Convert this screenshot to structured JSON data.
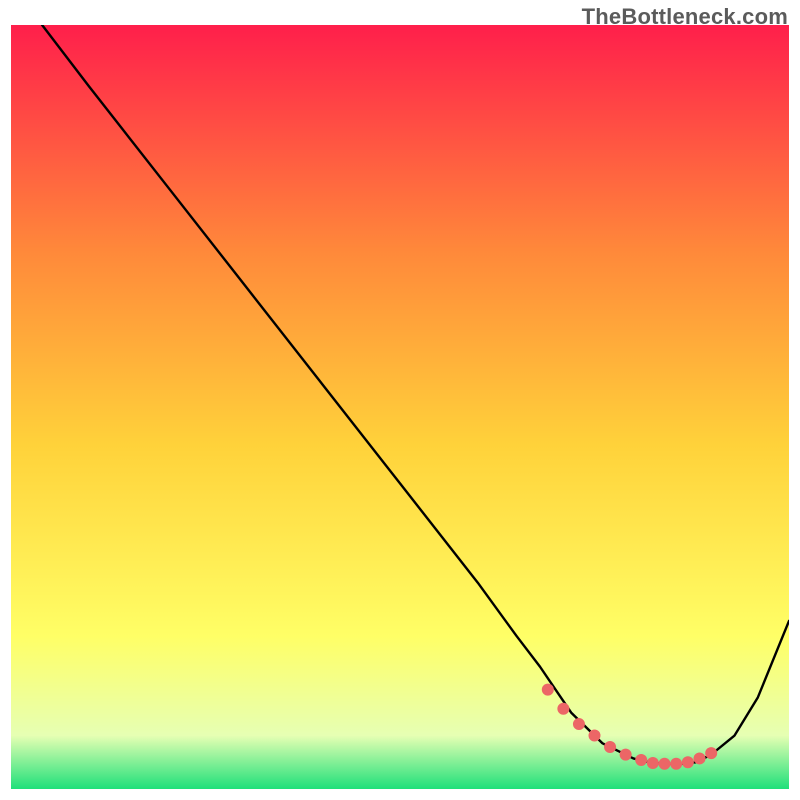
{
  "watermark": "TheBottleneck.com",
  "colors": {
    "grad_top": "#ff1f4b",
    "grad_mid_upper": "#ff8a3a",
    "grad_mid": "#ffd23a",
    "grad_lower": "#ffff66",
    "grad_bottom_light": "#e6ffb3",
    "grad_bottom": "#1fe07a",
    "line": "#000000",
    "marker": "#ec6666"
  },
  "chart_data": {
    "type": "line",
    "title": "",
    "xlabel": "",
    "ylabel": "",
    "xlim": [
      0,
      100
    ],
    "ylim": [
      0,
      100
    ],
    "series": [
      {
        "name": "curve",
        "x": [
          4,
          10,
          20,
          30,
          40,
          50,
          60,
          65,
          68,
          70,
          72,
          74,
          76,
          78,
          80,
          82,
          84,
          86,
          88,
          90,
          93,
          96,
          100
        ],
        "y": [
          100,
          92,
          79,
          66,
          53,
          40,
          27,
          20,
          16,
          13,
          10,
          8,
          6,
          5,
          4,
          3.5,
          3.3,
          3.3,
          3.5,
          4.5,
          7,
          12,
          22
        ]
      }
    ],
    "markers": {
      "name": "highlight-dots",
      "x": [
        69,
        71,
        73,
        75,
        77,
        79,
        81,
        82.5,
        84,
        85.5,
        87,
        88.5,
        90
      ],
      "y": [
        13,
        10.5,
        8.5,
        7,
        5.5,
        4.5,
        3.8,
        3.4,
        3.3,
        3.3,
        3.5,
        4,
        4.7
      ]
    }
  }
}
